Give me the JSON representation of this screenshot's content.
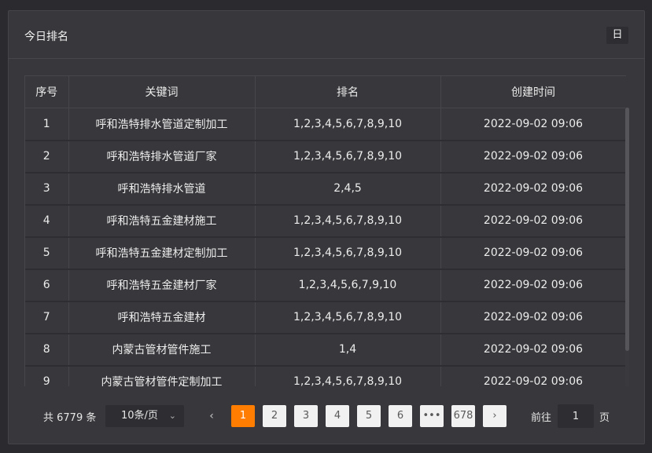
{
  "panel": {
    "title": "今日排名",
    "period_label": "日"
  },
  "table": {
    "headers": [
      "序号",
      "关键词",
      "排名",
      "创建时间"
    ],
    "rows": [
      [
        "1",
        "呼和浩特排水管道定制加工",
        "1,2,3,4,5,6,7,8,9,10",
        "2022-09-02 09:06"
      ],
      [
        "2",
        "呼和浩特排水管道厂家",
        "1,2,3,4,5,6,7,8,9,10",
        "2022-09-02 09:06"
      ],
      [
        "3",
        "呼和浩特排水管道",
        "2,4,5",
        "2022-09-02 09:06"
      ],
      [
        "4",
        "呼和浩特五金建材施工",
        "1,2,3,4,5,6,7,8,9,10",
        "2022-09-02 09:06"
      ],
      [
        "5",
        "呼和浩特五金建材定制加工",
        "1,2,3,4,5,6,7,8,9,10",
        "2022-09-02 09:06"
      ],
      [
        "6",
        "呼和浩特五金建材厂家",
        "1,2,3,4,5,6,7,9,10",
        "2022-09-02 09:06"
      ],
      [
        "7",
        "呼和浩特五金建材",
        "1,2,3,4,5,6,7,8,9,10",
        "2022-09-02 09:06"
      ],
      [
        "8",
        "内蒙古管材管件施工",
        "1,4",
        "2022-09-02 09:06"
      ],
      [
        "9",
        "内蒙古管材管件定制加工",
        "1,2,3,4,5,6,7,8,9,10",
        "2022-09-02 09:06"
      ]
    ]
  },
  "pager": {
    "total_text": "共 6779 条",
    "page_size": "10条/页",
    "pages": [
      "1",
      "2",
      "3",
      "4",
      "5",
      "6",
      "•••",
      "678"
    ],
    "active_page": "1",
    "goto_label": "前往",
    "goto_value": "1",
    "page_unit": "页",
    "prev_icon": "‹",
    "next_icon": "›"
  },
  "colors": {
    "accent": "#ff7d00",
    "panel_bg": "#38383c",
    "page_bg": "#2b2b2f"
  }
}
